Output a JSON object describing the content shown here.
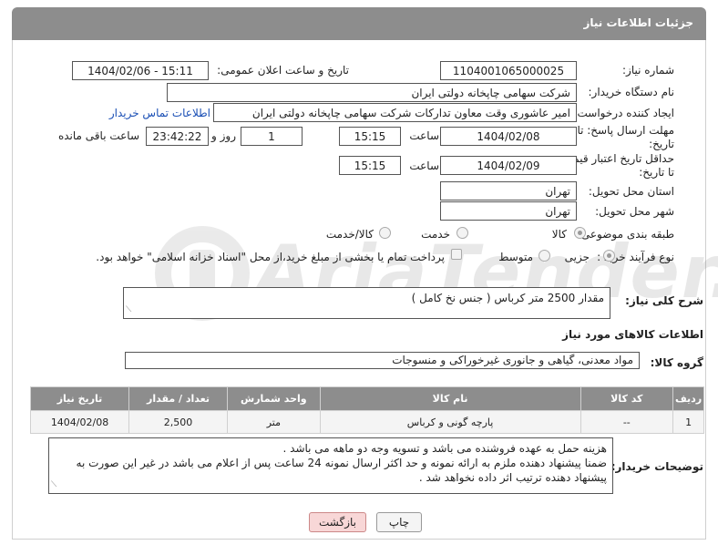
{
  "header": {
    "title": "جزئیات اطلاعات نیاز"
  },
  "form": {
    "need_number_label": "شماره نیاز:",
    "need_number": "1104001065000025",
    "announce_datetime_label": "تاریخ و ساعت اعلان عمومی:",
    "announce_datetime": "1404/02/06 - 15:11",
    "buyer_org_label": "نام دستگاه خریدار:",
    "buyer_org": "شرکت سهامی چاپخانه دولتی ایران",
    "requester_label": "ایجاد کننده درخواست:",
    "requester": "امیر عاشوری وقت معاون تدارکات شرکت سهامی چاپخانه دولتی ایران",
    "buyer_contact_link": "اطلاعات تماس خریدار",
    "reply_deadline_label_1": "مهلت ارسال پاسخ: تا",
    "reply_deadline_label_2": "تاریخ:",
    "reply_date": "1404/02/08",
    "time_label": "ساعت",
    "reply_time": "15:15",
    "day_count": "1",
    "day_and_label": "روز و",
    "remaining_time": "23:42:22",
    "remaining_label": "ساعت باقی مانده",
    "price_validity_label_1": "حداقل تاریخ اعتبار قیمت:",
    "price_validity_label_2": "تا تاریخ:",
    "validity_date": "1404/02/09",
    "validity_time": "15:15",
    "delivery_province_label": "استان محل تحویل:",
    "delivery_province": "تهران",
    "delivery_city_label": "شهر محل تحویل:",
    "delivery_city": "تهران",
    "category_label": "طبقه بندی موضوعی:",
    "category_options": [
      "کالا",
      "خدمت",
      "کالا/خدمت"
    ],
    "process_label": "نوع فرآیند خرید :",
    "process_options": [
      "جزیی",
      "متوسط"
    ],
    "payment_note": "پرداخت تمام یا بخشی از مبلغ خرید،از محل \"اسناد خزانه اسلامی\" خواهد بود.",
    "summary_label": "شرح کلی نیاز:",
    "summary": "مقدار 2500 متر کرباس ( جنس نخ کامل )",
    "goods_info_title": "اطلاعات کالاهای مورد نیاز",
    "goods_group_label": "گروه کالا:",
    "goods_group": "مواد معدنی، گیاهی و جانوری غیرخوراکی و منسوجات",
    "buyer_notes_label": "توضیحات خریدار:",
    "buyer_notes_lines": [
      "هزینه حمل به عهده فروشنده می باشد و تسویه وجه دو ماهه می باشد .",
      "ضمنا پیشنهاد دهنده ملزم به ارائه نمونه و  حد اکثر ارسال نمونه 24 ساعت پس از اعلام می باشد در غیر این صورت به",
      "پیشنهاد دهنده ترتیب  اثر داده نخواهد شد ."
    ]
  },
  "table": {
    "headers": [
      "ردیف",
      "کد کالا",
      "نام کالا",
      "واحد شمارش",
      "تعداد / مقدار",
      "تاریخ نیاز"
    ],
    "rows": [
      [
        "1",
        "--",
        "پارچه گونی و کرباس",
        "متر",
        "2,500",
        "1404/02/08"
      ]
    ]
  },
  "buttons": {
    "print": "چاپ",
    "back": "بازگشت"
  },
  "watermark": "AriaTender.neT",
  "colors": {
    "header_bg": "#8d8d8d",
    "link": "#1a4fb5",
    "back_button": "#f8d7d7"
  }
}
